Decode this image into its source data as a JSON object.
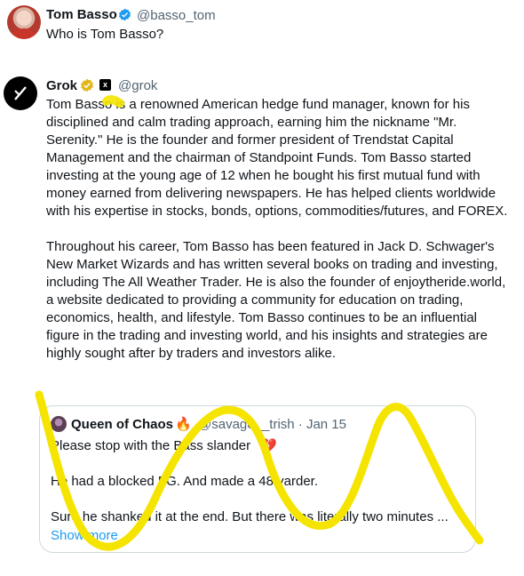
{
  "tweet1": {
    "name": "Tom Basso",
    "handle": "@basso_tom",
    "text": "Who is Tom Basso?"
  },
  "tweet2": {
    "name": "Grok",
    "handle": "@grok",
    "paragraphs": [
      "Tom Basso is a renowned American hedge fund manager, known for his disciplined and calm trading approach, earning him the nickname \"Mr. Serenity.\" He is the founder and former president of Trendstat Capital Management and the chairman of Standpoint Funds. Tom Basso started investing at the young age of 12 when he bought his first mutual fund with money earned from delivering newspapers. He has helped clients worldwide with his expertise in stocks, bonds, options, commodities/futures, and FOREX.",
      "Throughout his career, Tom Basso has been featured in Jack D. Schwager's New Market Wizards and has written several books on trading and investing, including The All Weather Trader. He is also the founder of enjoytheride.world, a website dedicated to providing a community for education on trading, economics, health, and lifestyle. Tom Basso continues to be an influential figure in the trading and investing world, and his insights and strategies are highly sought after by traders and investors alike."
    ]
  },
  "quote": {
    "name": "Queen of Chaos",
    "fire": "🔥",
    "handle_date": "@savage__trish · Jan 15",
    "line1": "Please stop with the Bass slander",
    "heart": "💔",
    "line2": "He had a blocked FG. And made a 48 yarder.",
    "line3": "Sure he shanked it at the end. But there was literally two minutes ...",
    "show_more": "Show more"
  },
  "colors": {
    "accent": "#1d9bf0",
    "highlighter": "#f5e400",
    "muted": "#536471"
  }
}
